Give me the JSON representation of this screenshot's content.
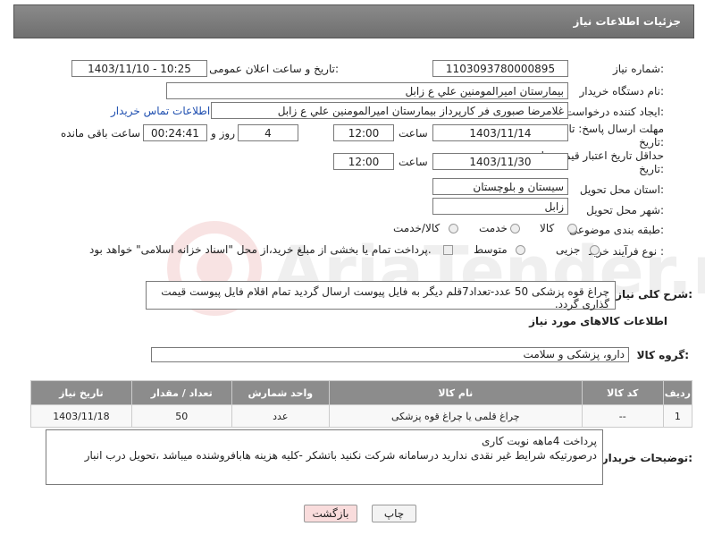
{
  "header": {
    "title": "جزئيات اطلاعات نياز"
  },
  "fields": {
    "need_number_label": "شماره نياز:",
    "need_number": "1103093780000895",
    "announce_label": "تاريخ و ساعت اعلان عمومی:",
    "announce_value": "1403/11/10 - 10:25",
    "buyer_label": "نام دستگاه خريدار:",
    "buyer": "بيمارستان اميرالمومنين علي  ع  زابل",
    "creator_label": "ايجاد كننده درخواست:",
    "creator": "غلامرضا صبوری فر كارپرداز بيمارستان اميرالمومنين علي  ع  زابل",
    "contact_link": "اطلاعات تماس خريدار",
    "deadline_label": "مهلت ارسال پاسخ: تا تاريخ:",
    "deadline_date": "1403/11/14",
    "time_label": "ساعت",
    "deadline_time": "12:00",
    "days_value": "4",
    "days_label": "روز و",
    "remaining_time": "00:24:41",
    "remaining_label": "ساعت باقی مانده",
    "validity_label": "حداقل تاريخ اعتبار قيمت: تا تاريخ:",
    "validity_date": "1403/11/30",
    "validity_time": "12:00",
    "province_label": "استان محل تحويل:",
    "province": "سيستان و بلوچستان",
    "city_label": "شهر محل تحويل:",
    "city": "زابل",
    "category_label": "طبقه بندی موضوعی:",
    "category_options": [
      "كالا",
      "خدمت",
      "كالا/خدمت"
    ],
    "purchase_label": "نوع فرآيند خريد :",
    "purchase_options": [
      "جزيی",
      "متوسط"
    ],
    "payment_note": "پرداخت تمام يا بخشی از مبلغ خريد،از محل \"اسناد خزانه اسلامی\" خواهد بود.",
    "description_label": "شرح كلی نياز:",
    "description": "چراغ قوه پزشكی 50 عدد-تعداد7قلم ديگر به فايل پيوست ارسال گرديد تمام اقلام فايل پيوست قيمت گذاری گردد.",
    "goods_info_title": "اطلاعات كالاهای مورد نياز",
    "goods_group_label": "گروه كالا:",
    "goods_group": "دارو، پزشكی و سلامت",
    "buyer_notes_label": "توضيحات خريدار:",
    "buyer_notes_line1": "پرداخت 4ماهه نوبت كاری",
    "buyer_notes_line2": "درصورتيكه شرايط غير نقدی نداريد درسامانه شركت نكنيد باتشكر -كليه هزينه هابافروشنده ميباشد ،تحويل درب انبار"
  },
  "table": {
    "headers": [
      "رديف",
      "كد كالا",
      "نام كالا",
      "واحد شمارش",
      "تعداد / مقدار",
      "تاريخ نياز"
    ],
    "rows": [
      {
        "row": "1",
        "code": "--",
        "name": "چراغ قلمی يا چراغ قوه پزشكی",
        "unit": "عدد",
        "qty": "50",
        "date": "1403/11/18"
      }
    ]
  },
  "buttons": {
    "print": "چاپ",
    "back": "بازگشت"
  },
  "watermark": "AriaTender.net",
  "colors": {
    "header_bg": "#7c7c7c",
    "link": "#1f4fb0",
    "back_button": "#f9dcdc"
  }
}
